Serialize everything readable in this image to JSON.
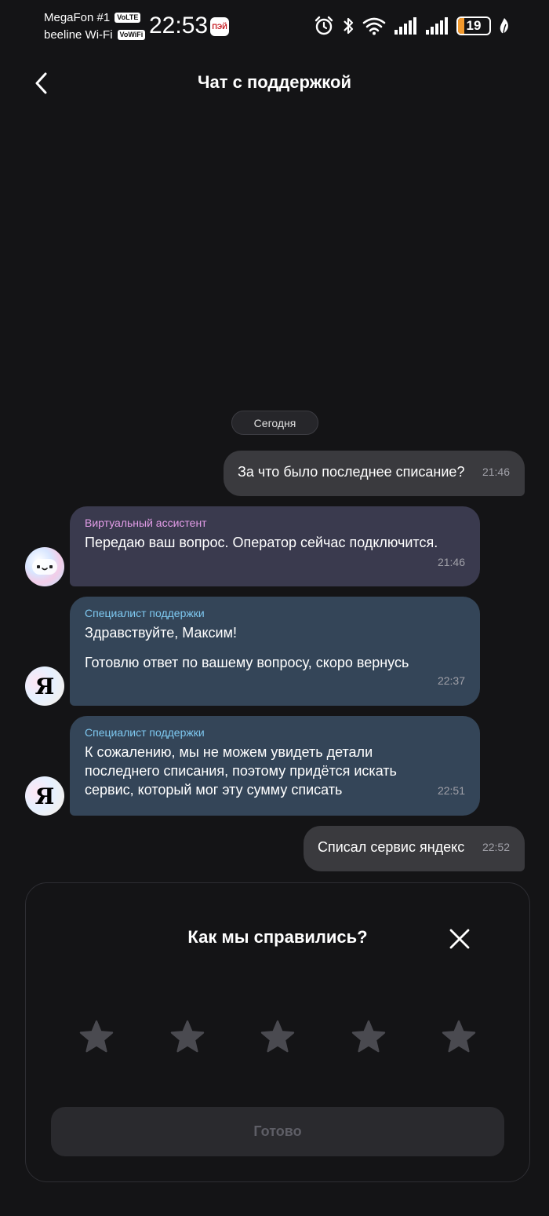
{
  "status_bar": {
    "carrier1": "MegaFon #1",
    "carrier1_tag": "VoLTE",
    "carrier2": "beeline Wi-Fi",
    "carrier2_tag": "VoWiFi",
    "time": "22:53",
    "app_badge": "ПЭЙ",
    "battery_percent": "19",
    "battery_level": 0.19,
    "battery_color": "#f29a2e",
    "icons": [
      "alarm-icon",
      "bluetooth-icon",
      "wifi-icon",
      "signal-icon",
      "signal-icon",
      "battery-icon",
      "leaf-icon"
    ]
  },
  "header": {
    "title": "Чат с поддержкой",
    "back_icon": "chevron-left-icon"
  },
  "date_chip": "Сегодня",
  "messages": [
    {
      "direction": "out",
      "text": "За что было последнее списание?",
      "time": "21:46"
    },
    {
      "direction": "in",
      "sender": "Виртуальный ассистент",
      "sender_color": "#e39de8",
      "text": "Передаю ваш вопрос. Оператор сейчас подключится.",
      "time": "21:46",
      "avatar": "assistant-avatar"
    },
    {
      "direction": "in",
      "sender": "Специалист поддержки",
      "sender_color": "#7ec8f0",
      "text": "Здравствуйте, Максим!",
      "text2": "Готовлю ответ по вашему вопросу, скоро вернусь",
      "time": "22:37",
      "avatar": "yandex-avatar"
    },
    {
      "direction": "in",
      "sender": "Специалист поддержки",
      "sender_color": "#7ec8f0",
      "lines": [
        "К сожалению, мы не можем увидеть детали",
        "последнего списания, поэтому придётся искать",
        "сервис, который мог эту сумму списать"
      ],
      "time": "22:51",
      "avatar": "yandex-avatar"
    },
    {
      "direction": "out",
      "text": "Списал сервис яндекс",
      "time": "22:52"
    }
  ],
  "avatar_letter": "Я",
  "rating": {
    "title": "Как мы справились?",
    "close_icon": "close-icon",
    "star_icon": "star-icon",
    "star_count": 5,
    "selected": 0,
    "done_label": "Готово"
  },
  "colors": {
    "background": "#141416",
    "outgoing_bubble": "#3a3a3e",
    "assistant_bubble": "#3a3a4e",
    "support_bubble": "#344558",
    "star_inactive": "#4a4a50"
  }
}
